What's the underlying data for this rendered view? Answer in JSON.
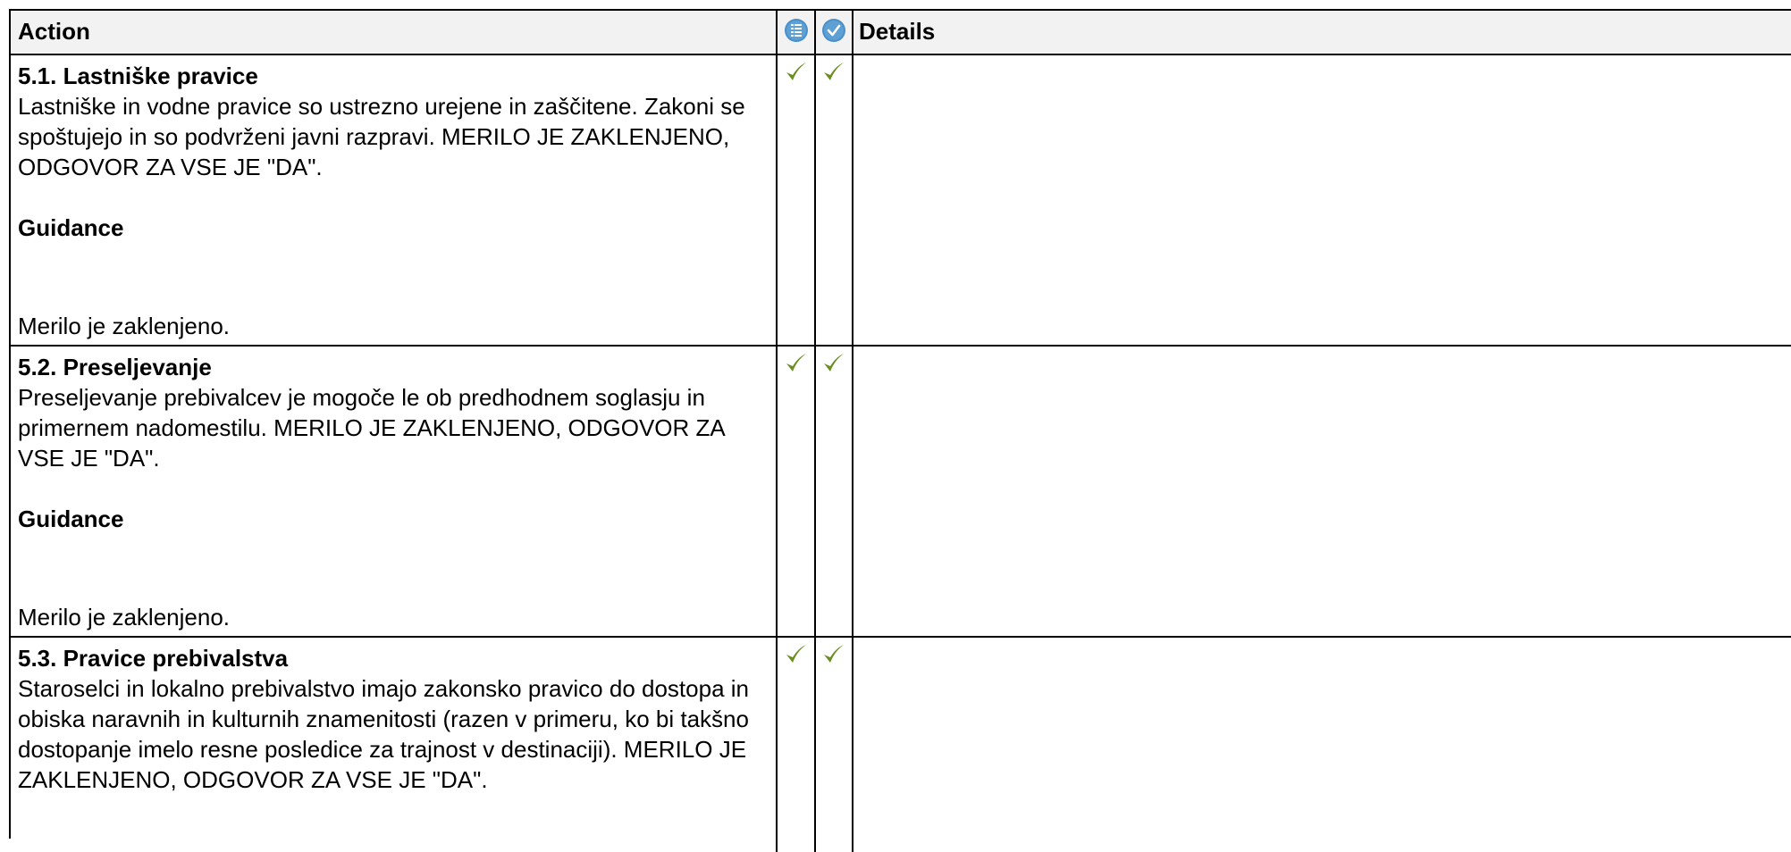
{
  "header": {
    "action_label": "Action",
    "details_label": "Details",
    "icon1": "list-icon",
    "icon2": "check-circle-icon",
    "icon_color": "#4a90c8"
  },
  "check_color": "#6b8e23",
  "rows": [
    {
      "title": "5.1. Lastniške pravice",
      "body": "Lastniške in vodne pravice so ustrezno urejene in zaščitene. Zakoni se spoštujejo in so podvrženi javni razpravi. MERILO JE ZAKLENJENO, ODGOVOR ZA VSE JE \"DA\".",
      "guidance_label": "Guidance",
      "locked_text": "Merilo je zaklenjeno."
    },
    {
      "title": "5.2. Preseljevanje",
      "body": "Preseljevanje prebivalcev je mogoče le ob predhodnem soglasju in primernem nadomestilu. MERILO JE ZAKLENJENO, ODGOVOR ZA VSE JE \"DA\".",
      "guidance_label": "Guidance",
      "locked_text": "Merilo je zaklenjeno."
    },
    {
      "title": "5.3. Pravice prebivalstva",
      "body": "Staroselci in lokalno prebivalstvo imajo zakonsko pravico do dostopa in obiska naravnih in kulturnih znamenitosti (razen v primeru, ko bi takšno dostopanje imelo resne posledice za trajnost v destinaciji). MERILO JE ZAKLENJENO, ODGOVOR ZA VSE JE \"DA\"."
    }
  ]
}
